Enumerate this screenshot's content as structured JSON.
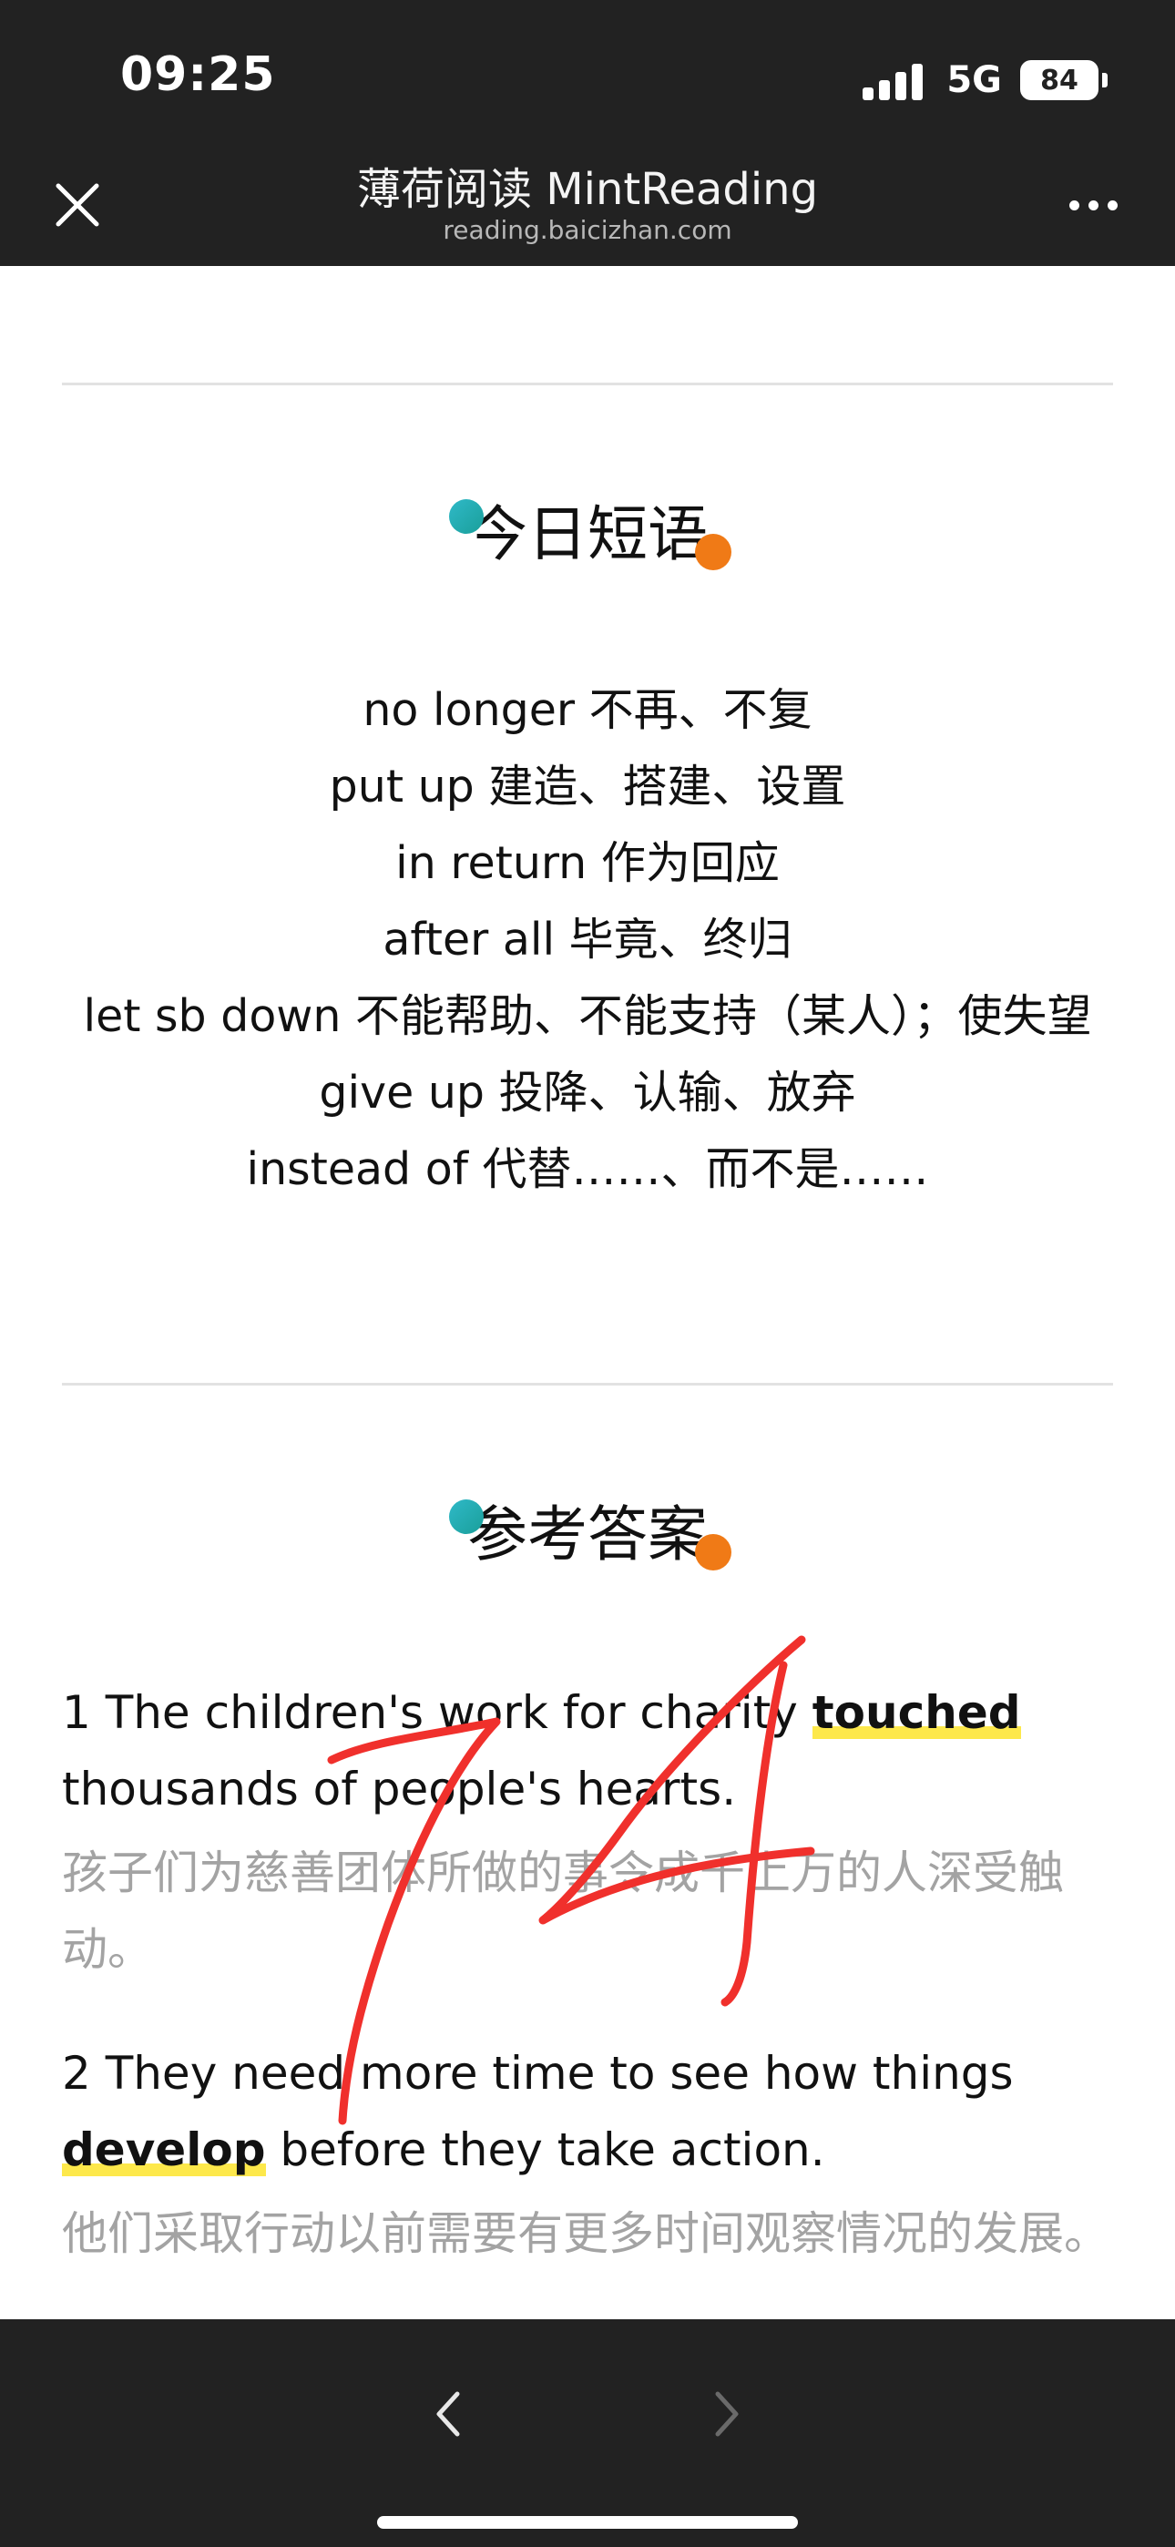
{
  "status_bar": {
    "time": "09:25",
    "network": "5G",
    "battery": "84"
  },
  "nav": {
    "title": "薄荷阅读 MintReading",
    "subtitle": "reading.baicizhan.com"
  },
  "phrases_section": {
    "title": "今日短语",
    "items": [
      "no longer 不再、不复",
      "put up 建造、搭建、设置",
      "in return 作为回应",
      "after all 毕竟、终归",
      "let sb down 不能帮助、不能支持（某人）；使失望",
      "give up 投降、认输、放弃",
      "instead of 代替……、而不是……"
    ]
  },
  "answers_section": {
    "title": "参考答案",
    "items": [
      {
        "before": "1 The children's work for charity ",
        "highlight": "touched",
        "after": " thousands of people's hearts.",
        "translation": "孩子们为慈善团体所做的事令成千上万的人深受触动。"
      },
      {
        "before": "2 They need more time to see how things ",
        "highlight": "develop",
        "after": " before they take action.",
        "translation": "他们采取行动以前需要有更多时间观察情况的发展。"
      }
    ]
  },
  "annotation": {
    "text": "14",
    "color": "#f0302c"
  },
  "colors": {
    "bar_background": "#222222",
    "highlight": "#fde84b",
    "dot_teal": "#2fb9c8",
    "dot_orange": "#f07a16",
    "translation_text": "#a3a3a3"
  }
}
